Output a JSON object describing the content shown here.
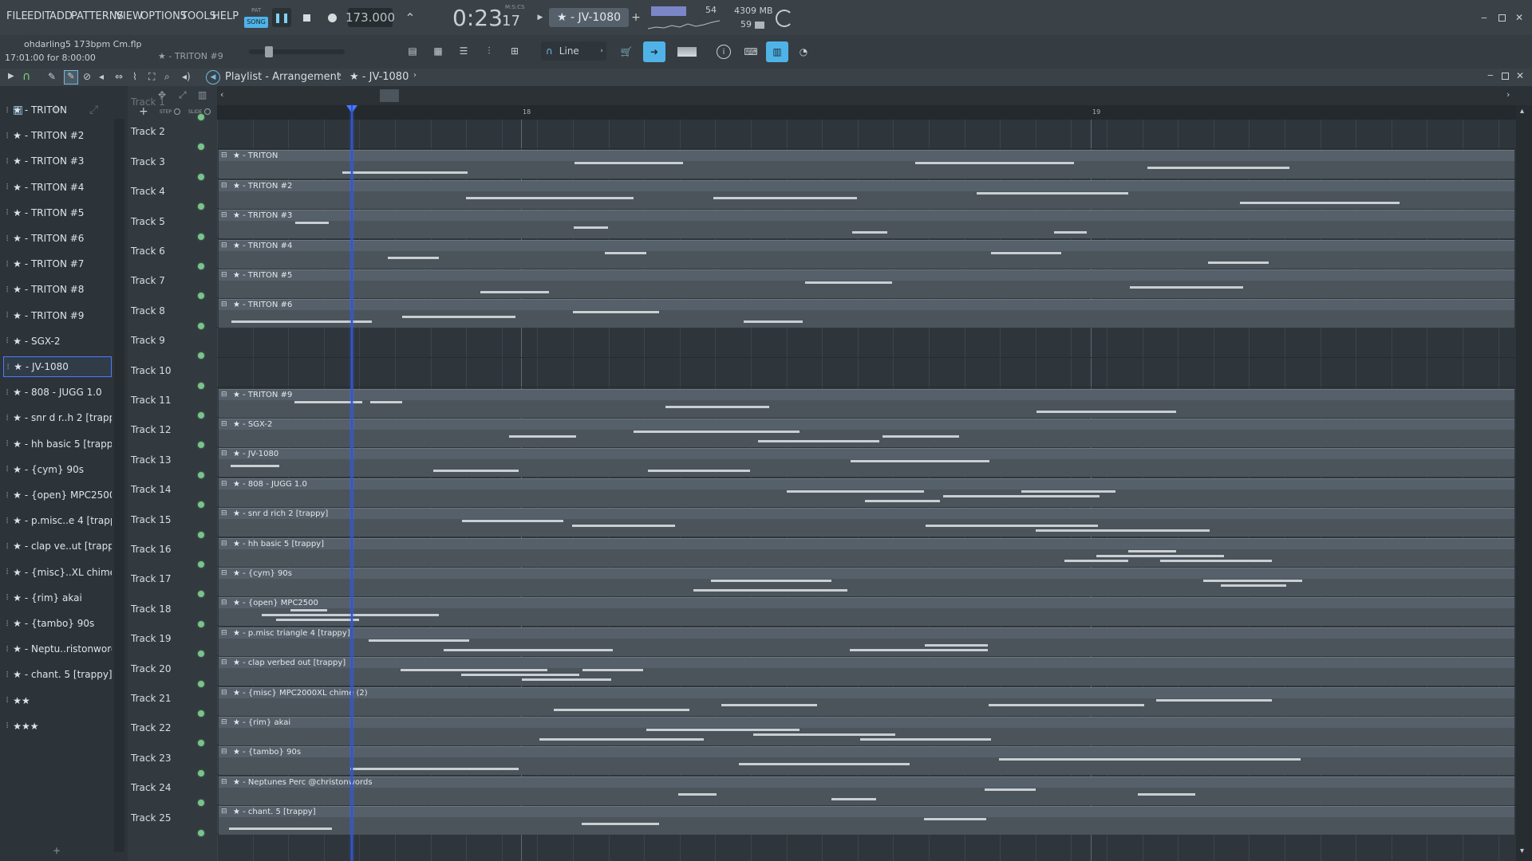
{
  "menu": [
    "FILE",
    "EDIT",
    "ADD",
    "PATTERNS",
    "VIEW",
    "OPTIONS",
    "TOOLS",
    "HELP"
  ],
  "transport": {
    "pat_label": "PAT",
    "song_label": "SONG",
    "tempo": "173.000",
    "time": "0:23",
    "time_frac": "17",
    "time_unit": "M:S:CS",
    "pattern": "★ - JV-1080",
    "cpu": "54",
    "memory": "4309 MB",
    "polyphony": "59"
  },
  "file": {
    "name": "ohdarling5 173bpm Cm.flp",
    "duration": "17:01:00 for 8:00:00",
    "channel_hint": "★ - TRITON #9"
  },
  "snap": "Line",
  "playlist": {
    "title": "Playlist - Arrangement",
    "pattern": "★ - JV-1080",
    "ruler_marks": [
      "18",
      "19"
    ],
    "step_label": "STEP",
    "slide_label": "SLIDE"
  },
  "patterns": [
    "★ - TRITON",
    "★ - TRITON #2",
    "★ - TRITON #3",
    "★ - TRITON #4",
    "★ - TRITON #5",
    "★ - TRITON #6",
    "★ - TRITON #7",
    "★ - TRITON #8",
    "★ - TRITON #9",
    "★ - SGX-2",
    "★ - JV-1080",
    "★ - 808 - JUGG 1.0",
    "★ - snr d r..h 2 [trappy]",
    "★ - hh basic 5 [trappy]",
    "★ - {cym} 90s",
    "★ - {open} MPC2500",
    "★ - p.misc..e 4 [trappy]",
    "★ - clap ve..ut [trappy]",
    "★ - {misc}..XL chime (2)",
    "★ - {rim} akai",
    "★ - {tambo} 90s",
    "★ - Neptu..ristonwords",
    "★ - chant. 5 [trappy]",
    "★★",
    "★★★"
  ],
  "tracks": [
    "Track 1",
    "Track 2",
    "Track 3",
    "Track 4",
    "Track 5",
    "Track 6",
    "Track 7",
    "Track 8",
    "Track 9",
    "Track 10",
    "Track 11",
    "Track 12",
    "Track 13",
    "Track 14",
    "Track 15",
    "Track 16",
    "Track 17",
    "Track 18",
    "Track 19",
    "Track 20",
    "Track 21",
    "Track 22",
    "Track 23",
    "Track 24",
    "Track 25"
  ],
  "clips": [
    {
      "track": 2,
      "label": "★ - TRITON"
    },
    {
      "track": 3,
      "label": "★ - TRITON #2"
    },
    {
      "track": 4,
      "label": "★ - TRITON #3"
    },
    {
      "track": 5,
      "label": "★ - TRITON #4"
    },
    {
      "track": 6,
      "label": "★ - TRITON #5"
    },
    {
      "track": 7,
      "label": "★ - TRITON #6"
    },
    {
      "track": 10,
      "label": "★ - TRITON #9"
    },
    {
      "track": 11,
      "label": "★ - SGX-2"
    },
    {
      "track": 12,
      "label": "★ - JV-1080"
    },
    {
      "track": 13,
      "label": "★ - 808 - JUGG 1.0"
    },
    {
      "track": 14,
      "label": "★ - snr d rich 2 [trappy]"
    },
    {
      "track": 15,
      "label": "★ - hh basic 5 [trappy]"
    },
    {
      "track": 16,
      "label": "★ - {cym} 90s"
    },
    {
      "track": 17,
      "label": "★ - {open} MPC2500"
    },
    {
      "track": 18,
      "label": "★ - p.misc triangle 4 [trappy]"
    },
    {
      "track": 19,
      "label": "★ - clap verbed out [trappy]"
    },
    {
      "track": 20,
      "label": "★ - {misc} MPC2000XL chime (2)"
    },
    {
      "track": 21,
      "label": "★ - {rim} akai"
    },
    {
      "track": 22,
      "label": "★ - {tambo} 90s"
    },
    {
      "track": 23,
      "label": "★ - Neptunes Perc @christonwords"
    },
    {
      "track": 24,
      "label": "★ - chant. 5 [trappy]"
    }
  ],
  "colors": {
    "playhead": "#2f55d4",
    "accent": "#4fb3e8",
    "led": "#7cc28d"
  }
}
